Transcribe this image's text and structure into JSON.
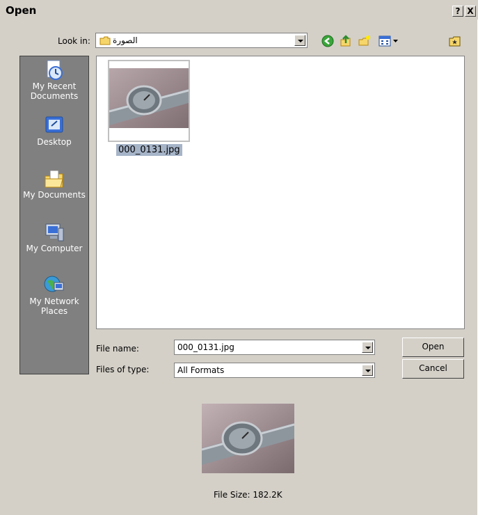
{
  "window": {
    "title": "Open",
    "help_label": "?",
    "close_label": "X"
  },
  "lookin": {
    "label": "Look in:",
    "value": "الصورة"
  },
  "toolbar": {
    "icons": [
      "back-icon",
      "up-folder-icon",
      "new-folder-icon",
      "view-menu-icon",
      "favorites-icon"
    ]
  },
  "places": [
    {
      "label_line1": "My Recent",
      "label_line2": "Documents",
      "icon": "recent-documents-icon"
    },
    {
      "label_line1": "Desktop",
      "label_line2": "",
      "icon": "desktop-icon"
    },
    {
      "label_line1": "My Documents",
      "label_line2": "",
      "icon": "my-documents-icon"
    },
    {
      "label_line1": "My Computer",
      "label_line2": "",
      "icon": "my-computer-icon"
    },
    {
      "label_line1": "My Network",
      "label_line2": "Places",
      "icon": "network-places-icon"
    }
  ],
  "files": [
    {
      "name": "000_0131.jpg",
      "selected": true
    }
  ],
  "filename": {
    "label": "File name:",
    "value": "000_0131.jpg"
  },
  "filetype": {
    "label": "Files of type:",
    "value": "All Formats"
  },
  "buttons": {
    "open": "Open",
    "cancel": "Cancel"
  },
  "preview": {
    "file_size": "File Size: 182.2K"
  }
}
